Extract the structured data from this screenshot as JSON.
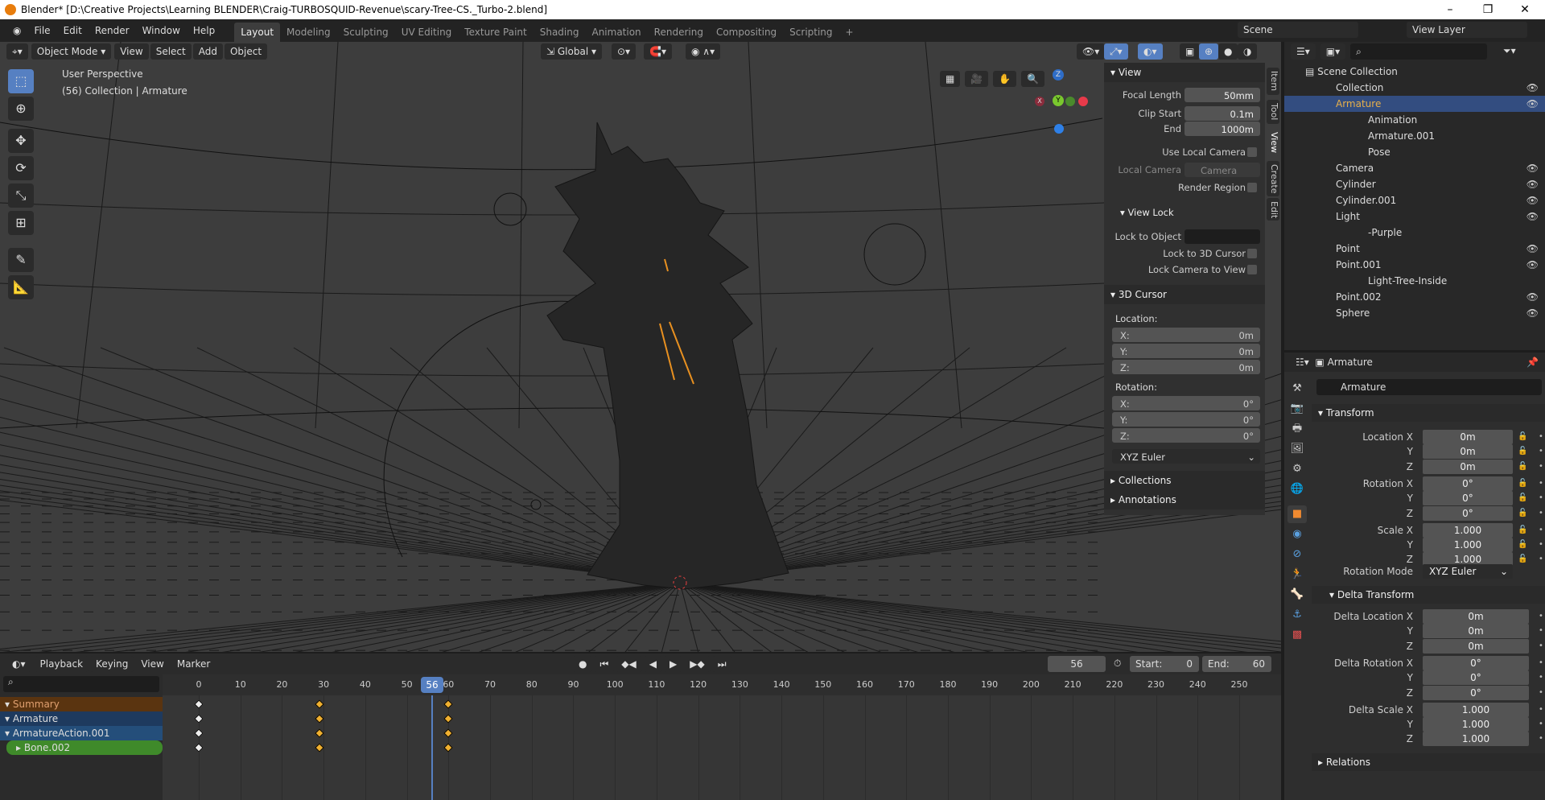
{
  "window": {
    "title": "Blender* [D:\\Creative Projects\\Learning BLENDER\\Craig-TURBOSQUID-Revenue\\scary-Tree-CS._Turbo-2.blend]"
  },
  "menu": [
    "File",
    "Edit",
    "Render",
    "Window",
    "Help"
  ],
  "workspaces": [
    "Layout",
    "Modeling",
    "Sculpting",
    "UV Editing",
    "Texture Paint",
    "Shading",
    "Animation",
    "Rendering",
    "Compositing",
    "Scripting",
    "+"
  ],
  "scene": "Scene",
  "view_layer": "View Layer",
  "viewport": {
    "mode": "Object Mode",
    "menus": [
      "View",
      "Select",
      "Add",
      "Object"
    ],
    "orientation": "Global",
    "info1": "User Perspective",
    "info2": "(56) Collection | Armature",
    "gizmo": {
      "x": "X",
      "y": "Y",
      "z": "Z"
    }
  },
  "npanel": {
    "tabs": [
      "Item",
      "Tool",
      "View",
      "Create",
      "Edit"
    ],
    "view_header": "View",
    "focal_length_label": "Focal Length",
    "focal_length": "50mm",
    "clip_start_label": "Clip Start",
    "clip_start": "0.1m",
    "end_label": "End",
    "end": "1000m",
    "use_local_camera": "Use Local Camera",
    "local_camera_label": "Local Camera",
    "local_camera": "Camera",
    "render_region": "Render Region",
    "view_lock": "View Lock",
    "lock_to_object": "Lock to Object",
    "lock_to_cursor": "Lock to 3D Cursor",
    "lock_camera": "Lock Camera to View",
    "cursor_header": "3D Cursor",
    "location": "Location:",
    "loc": [
      [
        "X:",
        "0m"
      ],
      [
        "Y:",
        "0m"
      ],
      [
        "Z:",
        "0m"
      ]
    ],
    "rotation": "Rotation:",
    "rot": [
      [
        "X:",
        "0°"
      ],
      [
        "Y:",
        "0°"
      ],
      [
        "Z:",
        "0°"
      ]
    ],
    "rotation_mode": "XYZ Euler",
    "collections": "Collections",
    "annotations": "Annotations"
  },
  "outliner": {
    "root": "Scene Collection",
    "items": [
      {
        "label": "Collection",
        "indent": 0,
        "color": "#ddd",
        "eye": true
      },
      {
        "label": "Armature",
        "indent": 0,
        "color": "#e8b04a",
        "eye": true,
        "selected": true
      },
      {
        "label": "Animation",
        "indent": 1,
        "color": "#ddd",
        "eye": false
      },
      {
        "label": "Armature.001",
        "indent": 1,
        "color": "#ddd",
        "eye": false
      },
      {
        "label": "Pose",
        "indent": 1,
        "color": "#ddd",
        "eye": false
      },
      {
        "label": "Camera",
        "indent": 0,
        "color": "#ddd",
        "eye": true
      },
      {
        "label": "Cylinder",
        "indent": 0,
        "color": "#ddd",
        "eye": true
      },
      {
        "label": "Cylinder.001",
        "indent": 0,
        "color": "#ddd",
        "eye": true
      },
      {
        "label": "Light",
        "indent": 0,
        "color": "#ddd",
        "eye": true
      },
      {
        "label": "-Purple",
        "indent": 1,
        "color": "#ddd",
        "eye": false
      },
      {
        "label": "Point",
        "indent": 0,
        "color": "#ddd",
        "eye": true
      },
      {
        "label": "Point.001",
        "indent": 0,
        "color": "#ddd",
        "eye": true
      },
      {
        "label": "Light-Tree-Inside",
        "indent": 1,
        "color": "#ddd",
        "eye": false
      },
      {
        "label": "Point.002",
        "indent": 0,
        "color": "#ddd",
        "eye": true
      },
      {
        "label": "Sphere",
        "indent": 0,
        "color": "#ddd",
        "eye": true
      }
    ]
  },
  "properties": {
    "object": "Armature",
    "name": "Armature",
    "transform": "Transform",
    "rows": [
      [
        "Location X",
        "0m"
      ],
      [
        "Y",
        "0m"
      ],
      [
        "Z",
        "0m"
      ],
      [
        "Rotation X",
        "0°"
      ],
      [
        "Y",
        "0°"
      ],
      [
        "Z",
        "0°"
      ],
      [
        "Scale X",
        "1.000"
      ],
      [
        "Y",
        "1.000"
      ],
      [
        "Z",
        "1.000"
      ]
    ],
    "rotation_mode_label": "Rotation Mode",
    "rotation_mode": "XYZ Euler",
    "delta": "Delta Transform",
    "delta_rows": [
      [
        "Delta Location X",
        "0m"
      ],
      [
        "Y",
        "0m"
      ],
      [
        "Z",
        "0m"
      ],
      [
        "Delta Rotation X",
        "0°"
      ],
      [
        "Y",
        "0°"
      ],
      [
        "Z",
        "0°"
      ],
      [
        "Delta Scale X",
        "1.000"
      ],
      [
        "Y",
        "1.000"
      ],
      [
        "Z",
        "1.000"
      ]
    ],
    "relations": "Relations"
  },
  "timeline": {
    "menus": [
      "Playback",
      "Keying",
      "View",
      "Marker"
    ],
    "current_frame": "56",
    "start_label": "Start:",
    "start": "0",
    "end_label": "End:",
    "end": "60",
    "ticks": [
      0,
      10,
      20,
      30,
      40,
      50,
      60,
      70,
      80,
      90,
      100,
      110,
      120,
      130,
      140,
      150,
      160,
      170,
      180,
      190,
      200,
      210,
      220,
      230,
      240,
      250
    ],
    "channels": [
      {
        "label": "Summary",
        "bg": "#5a3410"
      },
      {
        "label": "Armature",
        "bg": "#1e3a5e"
      },
      {
        "label": "ArmatureAction.001",
        "bg": "#244e7a"
      },
      {
        "label": "Bone.002",
        "bg": "#3f8a2a"
      }
    ],
    "keyframes": [
      0,
      29,
      60
    ]
  },
  "colors": {
    "accent": "#5680c2",
    "selected": "#334d80",
    "keyframe": "#f0b030"
  }
}
